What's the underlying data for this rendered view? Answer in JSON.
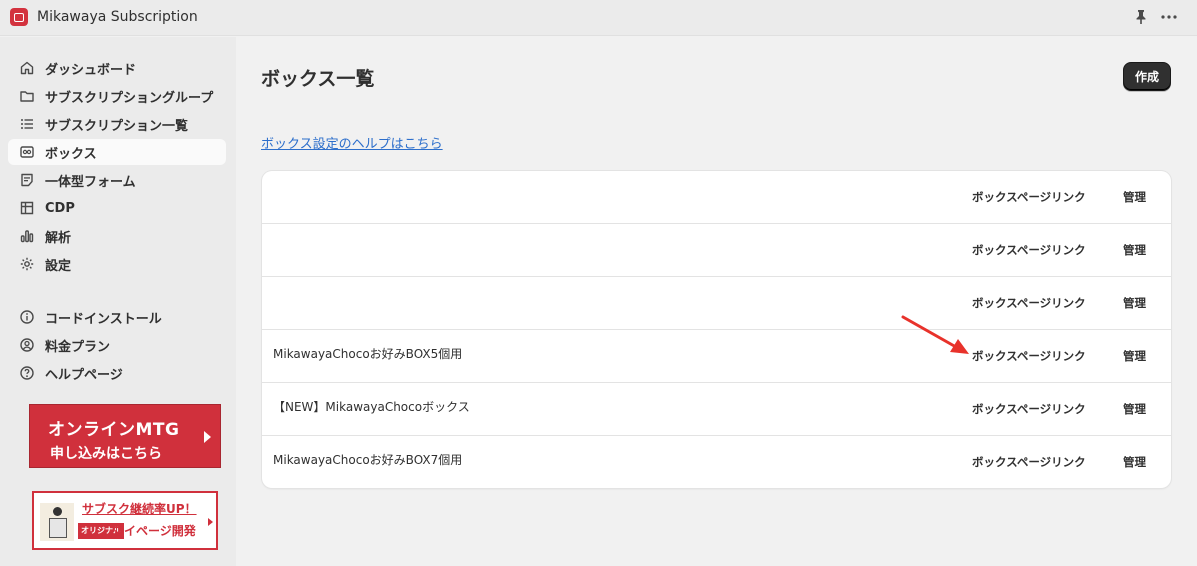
{
  "window": {
    "title": "Mikawaya Subscription",
    "pin_icon": "pin-icon",
    "more_icon": "more-icon"
  },
  "sidebar": {
    "items": [
      {
        "label": "ダッシュボード",
        "icon": "home-icon"
      },
      {
        "label": "サブスクリプショングループ",
        "icon": "folder-icon"
      },
      {
        "label": "サブスクリプション一覧",
        "icon": "list-icon"
      },
      {
        "label": "ボックス",
        "icon": "box-icon",
        "active": true
      },
      {
        "label": "一体型フォーム",
        "icon": "form-icon"
      },
      {
        "label": "CDP",
        "icon": "grid-icon"
      },
      {
        "label": "解析",
        "icon": "bar-chart-icon"
      },
      {
        "label": "設定",
        "icon": "gear-icon"
      }
    ],
    "secondary_items": [
      {
        "label": "コードインストール",
        "icon": "info-icon"
      },
      {
        "label": "料金プラン",
        "icon": "user-circle-icon"
      },
      {
        "label": "ヘルプページ",
        "icon": "question-icon"
      }
    ],
    "banner_mtg": {
      "line1": "オンラインMTG",
      "line2": "申し込みはこちら"
    },
    "banner_sub": {
      "line1": "サブスク継続率UP！",
      "tag": "オリジナル",
      "line2": "マイページ開発"
    }
  },
  "main": {
    "title": "ボックス一覧",
    "create_button": "作成",
    "help_link": "ボックス設定のヘルプはこちら",
    "rows": [
      {
        "name": "",
        "link": "ボックスページリンク",
        "manage": "管理"
      },
      {
        "name": "",
        "link": "ボックスページリンク",
        "manage": "管理"
      },
      {
        "name": "",
        "link": "ボックスページリンク",
        "manage": "管理"
      },
      {
        "name": "MikawayaChocoお好みBOX5個用",
        "link": "ボックスページリンク",
        "manage": "管理"
      },
      {
        "name": "【NEW】MikawayaChocoボックス",
        "link": "ボックスページリンク",
        "manage": "管理"
      },
      {
        "name": "MikawayaChocoお好みBOX7個用",
        "link": "ボックスページリンク",
        "manage": "管理"
      }
    ]
  },
  "annotation": {
    "arrow_color": "#e8322b",
    "arrow_icon": "red-arrow-annotation"
  }
}
